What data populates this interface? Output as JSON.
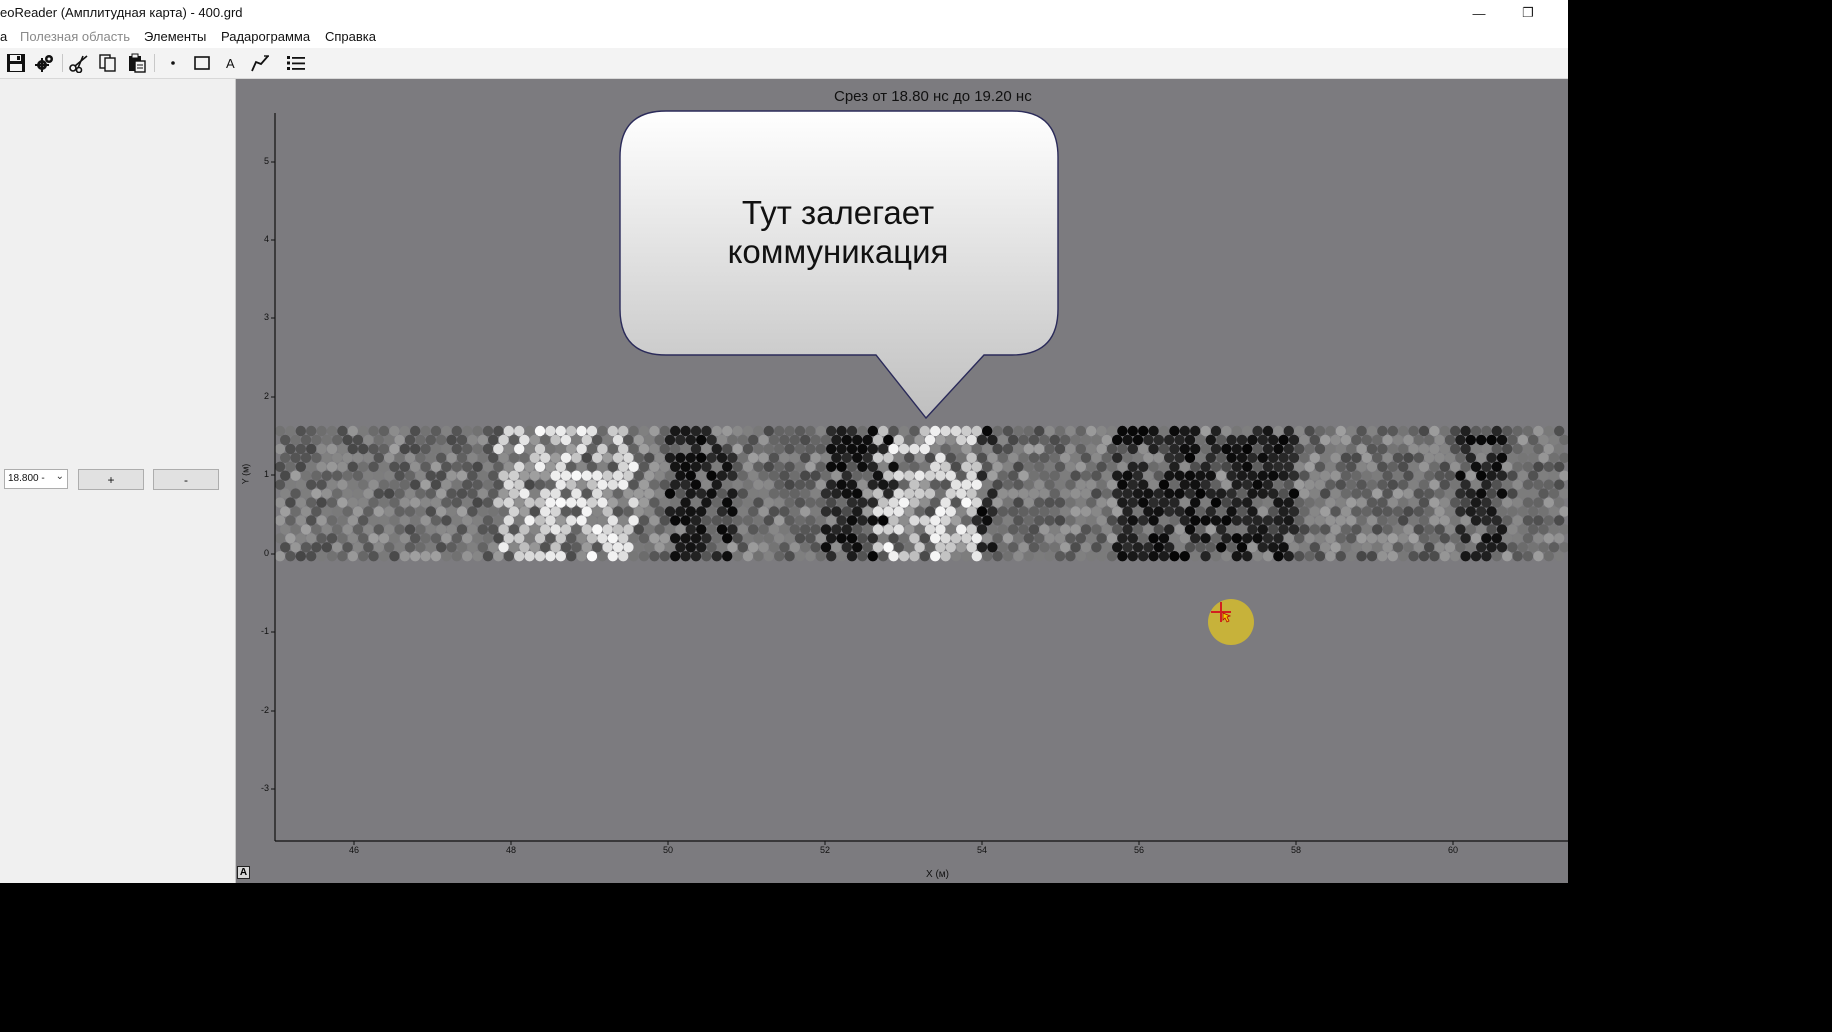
{
  "window": {
    "title": "eoReader (Амплитудная карта) - 400.grd",
    "minimize_glyph": "—",
    "restore_glyph": "❐"
  },
  "menu": {
    "items": [
      {
        "label": "а",
        "enabled": true
      },
      {
        "label": "Полезная область",
        "enabled": false
      },
      {
        "label": "Элементы",
        "enabled": true
      },
      {
        "label": "Радарограмма",
        "enabled": true
      },
      {
        "label": "Справка",
        "enabled": true
      }
    ]
  },
  "toolbar": {
    "icons": [
      "save-icon",
      "settings-gears-icon",
      "cut-icon",
      "copy-icon",
      "paste-icon",
      "point-icon",
      "rectangle-icon",
      "text-icon",
      "polyline-icon",
      "list-icon"
    ]
  },
  "left_panel": {
    "time_value": "18.800 -",
    "plus_label": "+",
    "minus_label": "-"
  },
  "plot": {
    "title": "Срез от 18.80 нс до 19.20 нс",
    "y_axis_label": "Y (м)",
    "x_axis_label": "X (м)",
    "y_ticks": [
      "5",
      "4",
      "3",
      "2",
      "1",
      "0",
      "-1",
      "-2",
      "-3"
    ],
    "x_ticks": [
      "46",
      "48",
      "50",
      "52",
      "54",
      "56",
      "58",
      "60"
    ],
    "background_color": "#7c7b7f",
    "callout_text_line1": "Тут залегает",
    "callout_text_line2": "коммуникация",
    "annotation_icon_label": "A",
    "cursor_marker_color": "#c7b23a"
  }
}
